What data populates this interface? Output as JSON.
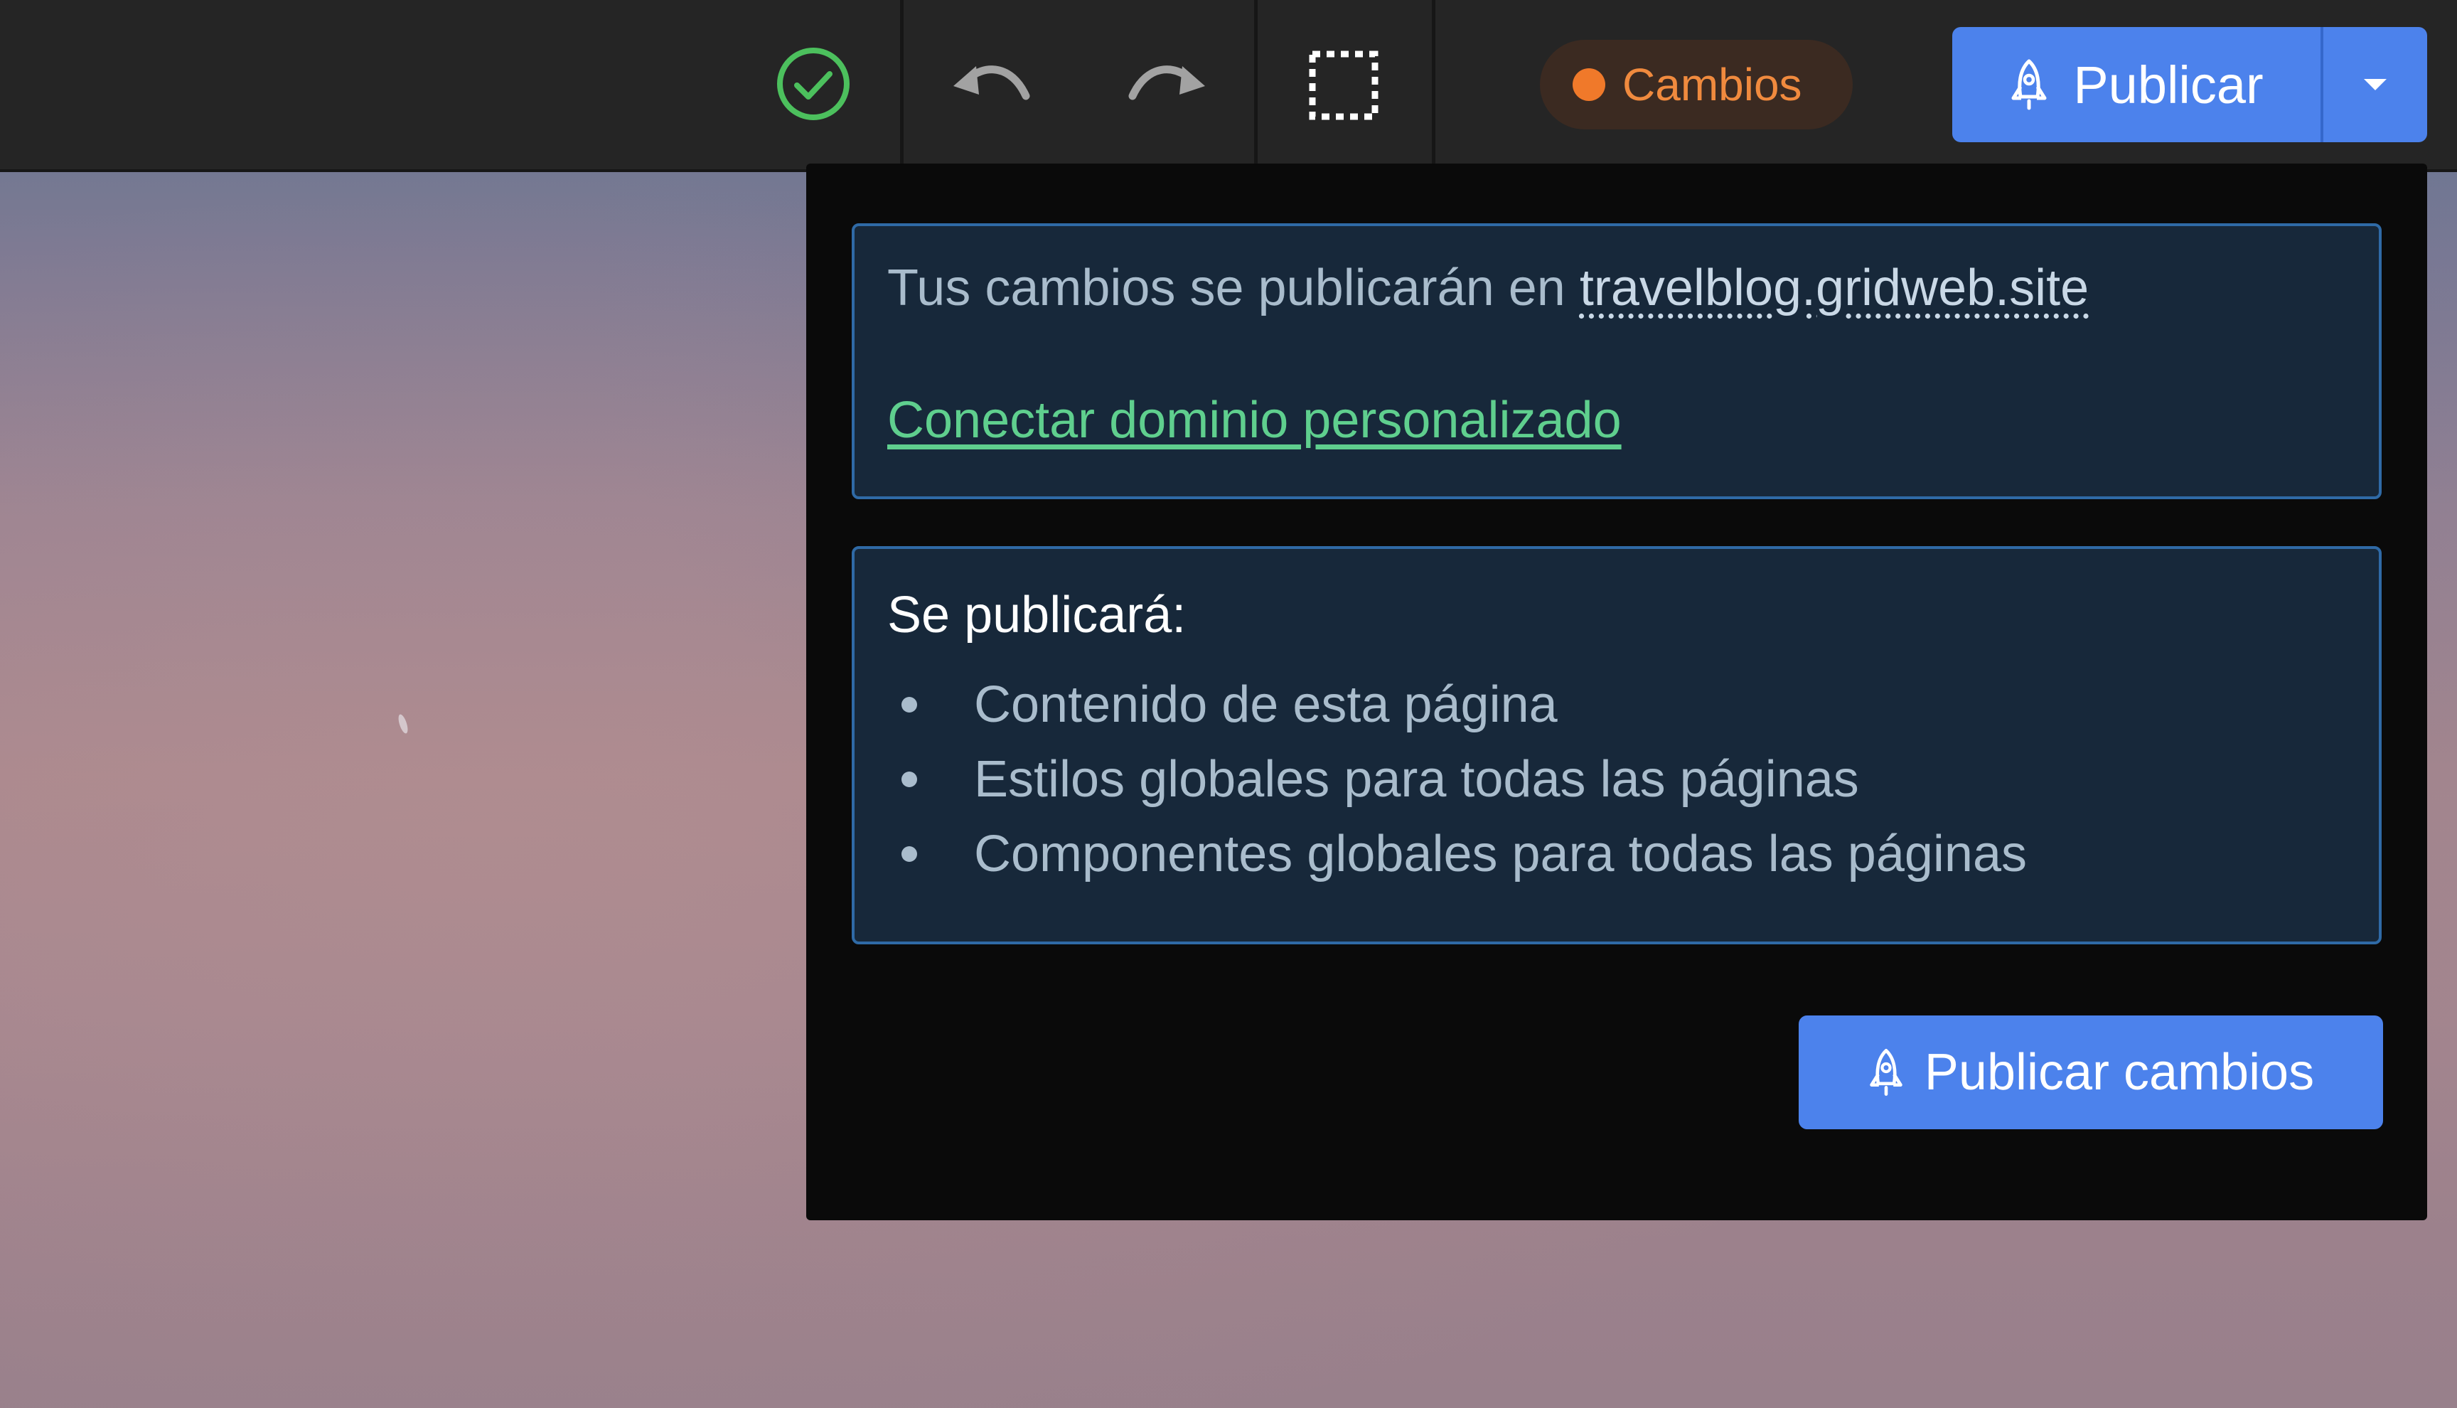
{
  "toolbar": {
    "saved_icon": "check-circle-icon",
    "undo_icon": "undo-icon",
    "redo_icon": "redo-icon",
    "select_icon": "dashed-selection-icon",
    "status": {
      "label": "Cambios",
      "color": "#f0792a"
    },
    "publish": {
      "label": "Publicar",
      "icon": "rocket-icon",
      "menu_icon": "caret-down-icon",
      "color": "#4c82ec"
    }
  },
  "popover": {
    "destination": {
      "prefix": "Tus cambios se publicarán en",
      "site": "travelblog.gridweb.site"
    },
    "connect_domain_label": "Conectar dominio personalizado",
    "scope": {
      "title": "Se publicará:",
      "items": [
        "Contenido de esta página",
        "Estilos globales para todas las páginas",
        "Componentes globales para todas las páginas"
      ]
    },
    "publish_changes_label": "Publicar cambios"
  },
  "colors": {
    "accent": "#4c82ec",
    "success": "#4cc05d",
    "link": "#5fcf8e",
    "changes": "#f0792a"
  }
}
